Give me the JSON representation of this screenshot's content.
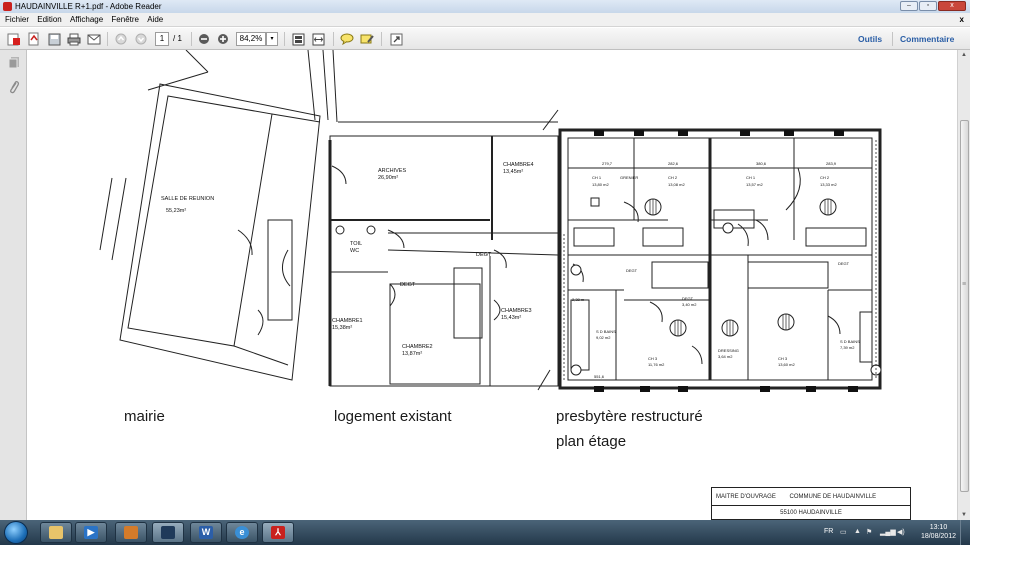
{
  "window": {
    "title": "HAUDAINVILLE R+1.pdf - Adobe Reader",
    "controls": [
      "–",
      "▫",
      "x"
    ]
  },
  "menu": {
    "items": [
      "Fichier",
      "Edition",
      "Affichage",
      "Fenêtre",
      "Aide"
    ],
    "close": "x"
  },
  "toolbar": {
    "page_current": "1",
    "page_total": "/ 1",
    "zoom": "84,2%",
    "zoom_arrow": "▾",
    "tools": "Outils",
    "comment": "Commentaire"
  },
  "icons": {
    "open": "open-folder-icon",
    "create": "create-pdf-icon",
    "save": "save-icon",
    "print": "print-icon",
    "email": "email-icon",
    "prev": "arrow-up-icon",
    "next": "arrow-down-icon",
    "zoom_out": "zoom-out-icon",
    "zoom_in": "zoom-in-icon",
    "fit_page": "fit-page-icon",
    "fit_width": "fit-width-icon",
    "comment": "comment-icon",
    "highlight": "highlight-icon",
    "fullscreen": "fullscreen-icon",
    "pages": "pages-panel-icon",
    "attachments": "paperclip-icon"
  },
  "document": {
    "captions": {
      "mairie": "mairie",
      "logement": "logement existant",
      "presbytere": "presbytère restructuré",
      "plan": "plan étage"
    },
    "rooms": {
      "salle": "SALLE DE REUNION",
      "salle_area": "55,23m²",
      "archives": "ARCHIVES",
      "archives_area": "26,90m²",
      "chambre4": "CHAMBRE4",
      "chambre4_area": "13,45m²",
      "toil": "TOIL",
      "wc": "WC",
      "degt1": "DEGT",
      "degt2": "DEGT",
      "chambre1": "CHAMBRE1",
      "chambre1_area": "15,38m²",
      "chambre2": "CHAMBRE2",
      "chambre2_area": "13,87m²",
      "chambre3": "CHAMBRE3",
      "chambre3_area": "15,43m²",
      "ch1_left": "CH 1",
      "ch1_left_area": "13,80 m2",
      "grenier": "GRENIER",
      "ch2_left": "CH 2",
      "ch2_left_area": "13,08 m2",
      "ch1_right": "CH 1",
      "ch1_right_area": "13,57 m2",
      "ch2_right": "CH 2",
      "ch2_right_area": "13,33 m2",
      "sdb_left": "S D BAINS",
      "sdb_left_area": "9,02 m2",
      "ch3_left": "CH 3",
      "ch3_left_area": "11,76 m2",
      "dressing": "DRESSING",
      "dressing_area": "3,64 m2",
      "ch3_right": "CH 3",
      "ch3_right_area": "13,60 m2",
      "sdb_right": "S D BAINS",
      "sdb_right_area": "7,39 m2",
      "degt3": "DEGT",
      "degt4": "DEGT",
      "degt5": "DEGT",
      "wc_area": "2,38 m",
      "degt_area": "3,40 m2",
      "dim1": "279,7",
      "dim2": "282,6",
      "dim3": "380,6",
      "dim4": "283,9",
      "dim5": "551,6"
    },
    "title_block": {
      "maitre": "MAITRE D'OUVRAGE",
      "commune": "COMMUNE DE HAUDAINVILLE",
      "address": "55100 HAUDAINVILLE"
    }
  },
  "taskbar": {
    "apps": [
      "explorer",
      "media-player",
      "paint",
      "media-center",
      "word",
      "internet-explorer",
      "adobe-reader"
    ],
    "lang": "FR",
    "time": "13:10",
    "date": "18/08/2012"
  }
}
